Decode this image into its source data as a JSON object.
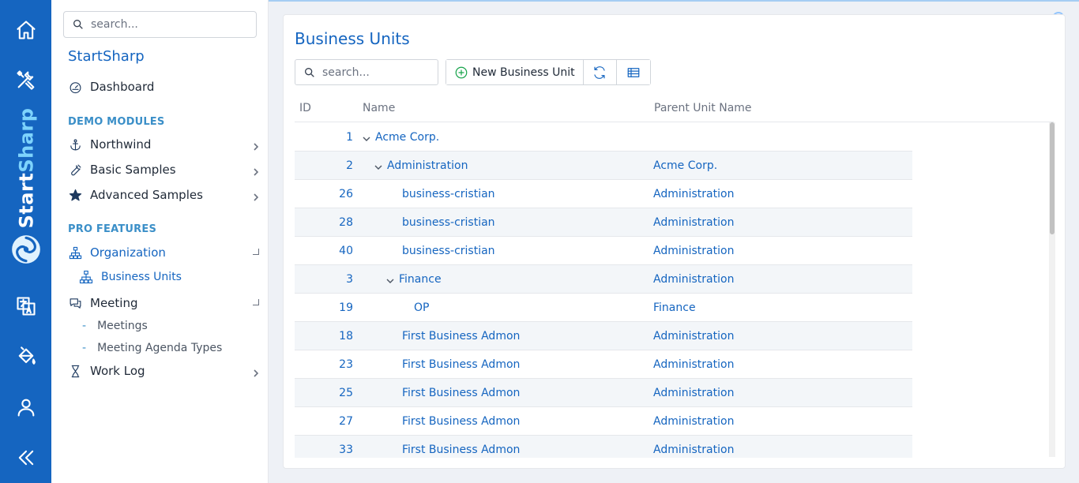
{
  "brand": {
    "start": "Start",
    "sharp": "Sharp"
  },
  "sidebar": {
    "search_placeholder": "search...",
    "app_title": "StartSharp",
    "dashboard": "Dashboard",
    "demo_modules_label": "DEMO MODULES",
    "northwind": "Northwind",
    "basic_samples": "Basic Samples",
    "advanced_samples": "Advanced Samples",
    "pro_features_label": "PRO FEATURES",
    "organization": "Organization",
    "business_units": "Business Units",
    "meeting": "Meeting",
    "meetings": "Meetings",
    "meeting_agenda_types": "Meeting Agenda Types",
    "work_log": "Work Log",
    "dash_char": "-"
  },
  "page": {
    "title": "Business Units",
    "search_placeholder": "search...",
    "new_button": "New Business Unit"
  },
  "grid": {
    "columns": {
      "id": "ID",
      "name": "Name",
      "parent": "Parent Unit Name"
    },
    "rows": [
      {
        "id": "1",
        "name": "Acme Corp.",
        "parent": ""
      },
      {
        "id": "2",
        "name": "Administration",
        "parent": "Acme Corp."
      },
      {
        "id": "26",
        "name": "business-cristian",
        "parent": "Administration"
      },
      {
        "id": "28",
        "name": "business-cristian",
        "parent": "Administration"
      },
      {
        "id": "40",
        "name": "business-cristian",
        "parent": "Administration"
      },
      {
        "id": "3",
        "name": "Finance",
        "parent": "Administration"
      },
      {
        "id": "19",
        "name": "OP",
        "parent": "Finance"
      },
      {
        "id": "18",
        "name": "First Business Admon",
        "parent": "Administration"
      },
      {
        "id": "23",
        "name": "First Business Admon",
        "parent": "Administration"
      },
      {
        "id": "25",
        "name": "First Business Admon",
        "parent": "Administration"
      },
      {
        "id": "27",
        "name": "First Business Admon",
        "parent": "Administration"
      },
      {
        "id": "33",
        "name": "First Business Admon",
        "parent": "Administration"
      }
    ]
  },
  "colors": {
    "rail": "#1565c0",
    "accent": "#1565c0",
    "section": "#3b8fc8",
    "add_icon": "#16a34a"
  }
}
